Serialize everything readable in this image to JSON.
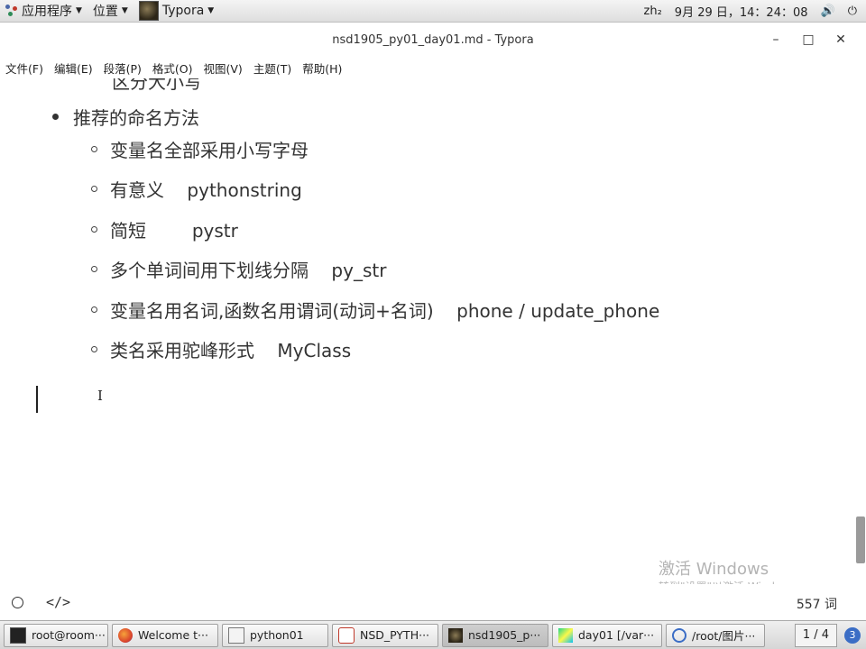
{
  "top_panel": {
    "apps_label": "应用程序",
    "places_label": "位置",
    "active_app": "Typora",
    "input_method": "zh₂",
    "datetime": "9月 29 日，14：24：08",
    "volume_icon": "speaker-icon",
    "power_icon": "power-icon"
  },
  "window": {
    "title": "nsd1905_py01_day01.md - Typora",
    "minimize": "–",
    "maximize": "□",
    "close": "✕"
  },
  "menu": {
    "items": [
      "文件(F)",
      "编辑(E)",
      "段落(P)",
      "格式(O)",
      "视图(V)",
      "主题(T)",
      "帮助(H)"
    ]
  },
  "editor": {
    "cut_line": "区分大小写",
    "heading_bullet": "推荐的命名方法",
    "sub_items": [
      "变量名全部采用小写字母",
      "有意义    pythonstring",
      "简短        pystr",
      "多个单词间用下划线分隔    py_str",
      "变量名用名词,函数名用谓词(动词+名词)    phone / update_phone",
      "类名采用驼峰形式    MyClass"
    ],
    "cursor_glyph": "I"
  },
  "watermark": {
    "line1": "激活 Windows",
    "line2": "转到\"设置\"以激活 Windows。"
  },
  "statusbar": {
    "code_icon": "</>",
    "word_count": "557 词"
  },
  "taskbar": {
    "tasks": [
      {
        "label": "root@room···",
        "icon": "terminal-icon"
      },
      {
        "label": "Welcome t···",
        "icon": "firefox-icon"
      },
      {
        "label": "python01",
        "icon": "file-icon"
      },
      {
        "label": "NSD_PYTH···",
        "icon": "document-icon"
      },
      {
        "label": "nsd1905_p···",
        "icon": "typora-icon"
      },
      {
        "label": "day01 [/var···",
        "icon": "pycharm-icon"
      },
      {
        "label": "/root/图片···",
        "icon": "image-viewer-icon"
      }
    ],
    "pager": "1 / 4",
    "badge": "3"
  },
  "colors": {
    "text": "#333333",
    "panel_bg": "#e8e8e8",
    "watermark": "#b4b4b4",
    "badge": "#3b6dc5"
  }
}
